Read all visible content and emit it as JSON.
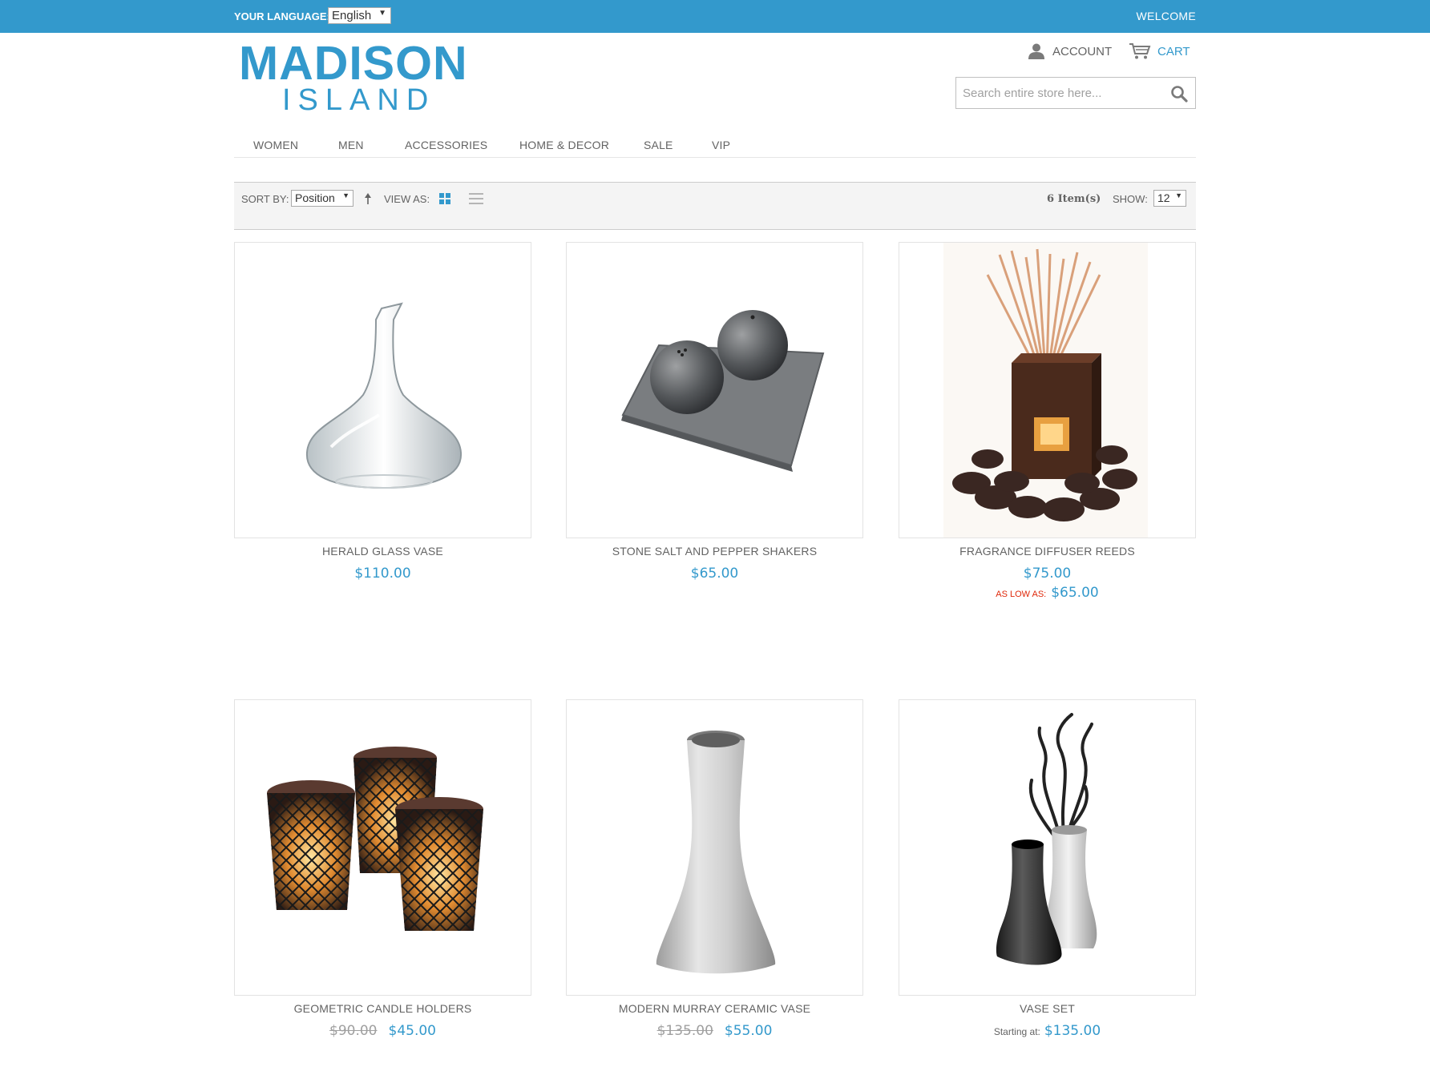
{
  "topbar": {
    "language_label": "YOUR LANGUAGE:",
    "language_value": "English",
    "welcome": "WELCOME"
  },
  "logo": {
    "main": "MADISON",
    "sub": "ISLAND"
  },
  "header": {
    "account_label": "ACCOUNT",
    "cart_label": "CART",
    "search_placeholder": "Search entire store here..."
  },
  "nav": {
    "items": [
      {
        "label": "WOMEN"
      },
      {
        "label": "MEN"
      },
      {
        "label": "ACCESSORIES"
      },
      {
        "label": "HOME & DECOR"
      },
      {
        "label": "SALE"
      },
      {
        "label": "VIP"
      }
    ]
  },
  "toolbar": {
    "sort_label": "SORT BY:",
    "sort_value": "Position",
    "view_label": "VIEW AS:",
    "items_count": "6 Item(s)",
    "show_label": "SHOW:",
    "show_value": "12"
  },
  "products": [
    {
      "name": "HERALD GLASS VASE",
      "price": "$110.00"
    },
    {
      "name": "STONE SALT AND PEPPER SHAKERS",
      "price": "$65.00"
    },
    {
      "name": "FRAGRANCE DIFFUSER REEDS",
      "price": "$75.00",
      "low_label": "AS LOW AS:",
      "low_price": "$65.00"
    },
    {
      "name": "GEOMETRIC CANDLE HOLDERS",
      "old_price": "$90.00",
      "price": "$45.00"
    },
    {
      "name": "MODERN MURRAY CERAMIC VASE",
      "old_price": "$135.00",
      "price": "$55.00"
    },
    {
      "name": "VASE SET",
      "start_label": "Starting at:",
      "price": "$135.00"
    }
  ],
  "colors": {
    "brand": "#3399cc",
    "text": "#636363",
    "sale_label": "#df280a"
  }
}
